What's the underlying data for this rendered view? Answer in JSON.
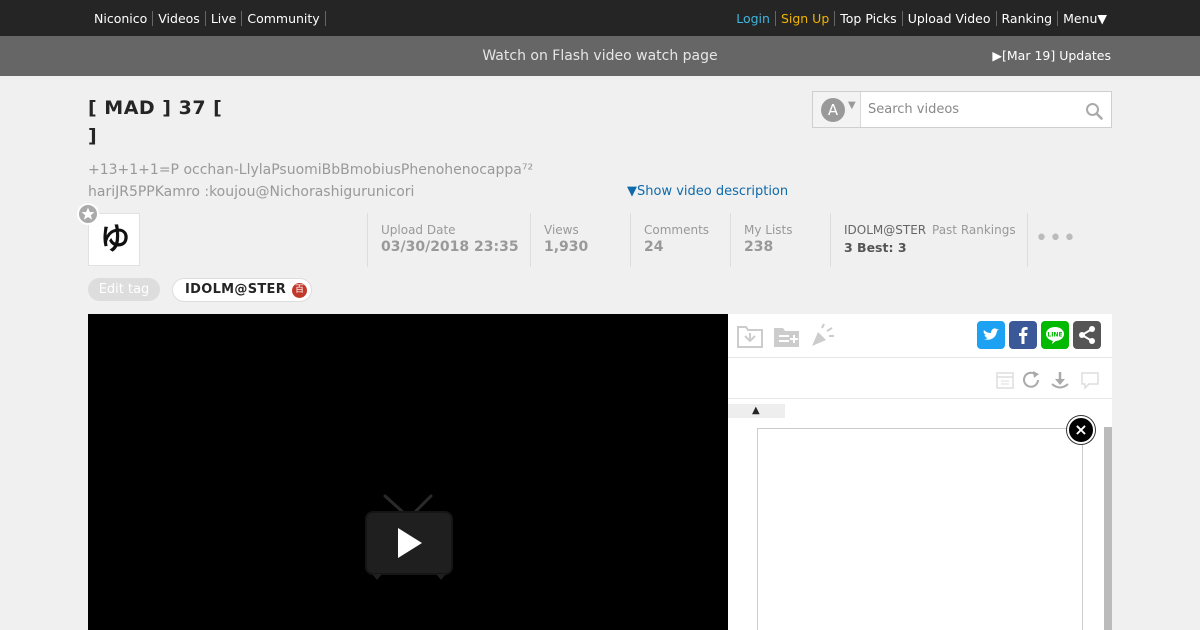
{
  "nav": {
    "left": [
      "Niconico",
      "Videos",
      "Live",
      "Community"
    ],
    "login": "Login",
    "signup": "Sign Up",
    "right": [
      "Top Picks",
      "Upload Video",
      "Ranking",
      "Menu▼"
    ]
  },
  "banner": {
    "text": "Watch on Flash video watch page",
    "updates": "▶[Mar 19] Updates"
  },
  "video": {
    "title": "[ MAD ] 37 [ ]",
    "subtitle": "+13+1+1=P occhan-LlylaPsuomiBbBmobiusPhenohenocappa⁷² hariJR5PPKamro :koujou@Nichorashigurunicori",
    "show_description": "▼Show video description"
  },
  "search": {
    "placeholder": "Search videos",
    "mode_letter": "A"
  },
  "uploader": {
    "avatar_glyph": "ゆ"
  },
  "stats": {
    "upload_label": "Upload Date",
    "upload_value": "03/30/2018 23:35",
    "views_label": "Views",
    "views_value": "1,930",
    "comments_label": "Comments",
    "comments_value": "24",
    "mylists_label": "My Lists",
    "mylists_value": "238",
    "ranking_name": "IDOLM@STER",
    "past_rankings": "Past Rankings",
    "ranking_value": "3  Best: 3",
    "more": "•••"
  },
  "tags": {
    "edit_label": "Edit tag",
    "items": [
      {
        "name": "IDOLM@STER",
        "icon": "百"
      }
    ]
  },
  "panel": {
    "sort_arrow": "▲",
    "close": "×"
  },
  "colors": {
    "nav_bg": "#252525",
    "banner_bg": "#666666",
    "login": "#3fb5dc",
    "signup": "#f0b400",
    "link": "#0e6aab",
    "twitter": "#1da1f2",
    "facebook": "#3b5998",
    "line": "#00b900",
    "share": "#555555"
  },
  "icons": [
    "star-icon",
    "search-icon",
    "play-icon",
    "tv-icon",
    "mylist-icon",
    "playlist-add-icon",
    "advertise-icon",
    "twitter-icon",
    "facebook-icon",
    "line-icon",
    "share-icon",
    "calendar-icon",
    "refresh-icon",
    "scroll-down-icon",
    "comment-icon",
    "close-icon"
  ]
}
